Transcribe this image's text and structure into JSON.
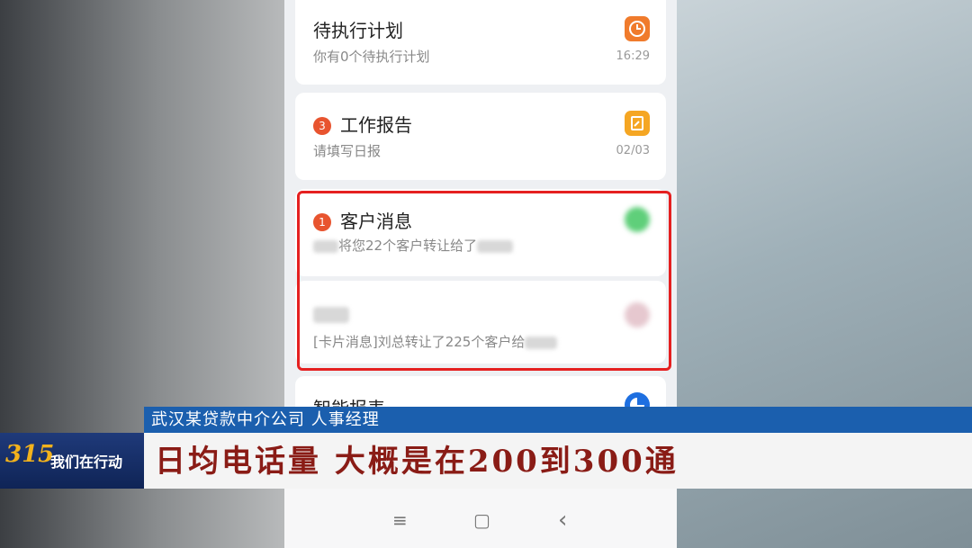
{
  "cards": {
    "plan": {
      "title": "待执行计划",
      "subtitle": "你有0个待执行计划",
      "time": "16:29",
      "icon": "clock-icon",
      "icon_color": "#f07b2c"
    },
    "report": {
      "badge": "3",
      "title": "工作报告",
      "subtitle": "请填写日报",
      "time": "02/03",
      "icon": "report-icon",
      "icon_color": "#f5a623"
    },
    "customer": {
      "badge": "1",
      "title": "客户消息",
      "subtitle": "将您22个客户转让给了"
    },
    "card_msg": {
      "subtitle": "[卡片消息]刘总转让了225个客户给"
    },
    "smart_report": {
      "title": "智能报表",
      "icon": "pie-chart-icon",
      "icon_color": "#1e6fe0"
    }
  },
  "caption": {
    "speaker": "武汉某贷款中介公司  人事经理",
    "quote": "日均电话量  大概是在200到300通"
  },
  "logo": {
    "number": "315",
    "text": "我们在行动"
  },
  "navbar": {
    "menu": "≡",
    "home": "▢",
    "back": "‹"
  },
  "colors": {
    "highlight": "#e52020",
    "caption_blue": "#1b5fae",
    "quote_red": "#8a1c16"
  }
}
